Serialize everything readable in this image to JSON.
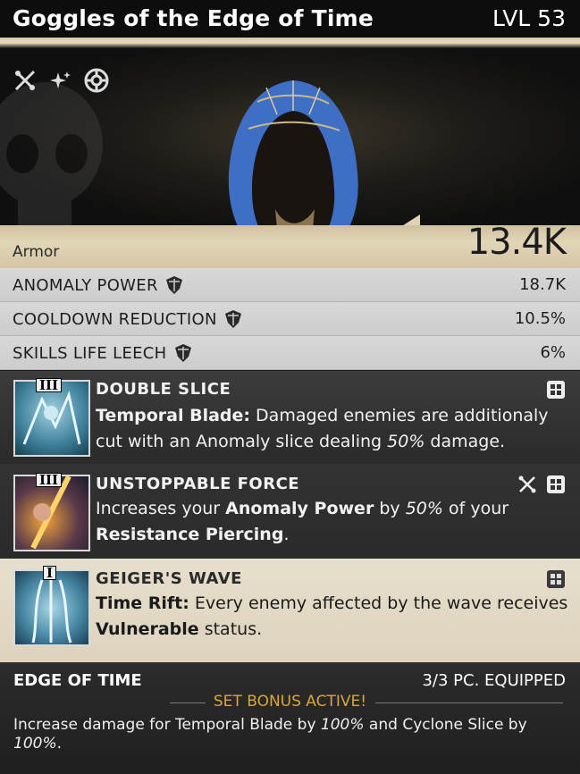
{
  "item": {
    "name": "Goggles of the Edge of Time",
    "level": "LVL 53",
    "hero_icons": [
      "crossed-tools-icon",
      "sparkle-icon",
      "crosshair-icon"
    ],
    "armor_label": "Armor",
    "armor_value": "13.4K"
  },
  "stats": [
    {
      "name": "ANOMALY POWER",
      "value": "18.7K",
      "icon": "gem-shield-icon"
    },
    {
      "name": "COOLDOWN REDUCTION",
      "value": "10.5%",
      "icon": "gem-shield-icon"
    },
    {
      "name": "SKILLS LIFE LEECH",
      "value": "6%",
      "icon": "gem-shield-icon"
    }
  ],
  "perks": [
    {
      "tier": "III",
      "name": "DOUBLE SLICE",
      "desc_lead": "Temporal Blade:",
      "desc_1": " Damaged enemies are additionaly cut with an Anomaly slice dealing ",
      "desc_em": "50%",
      "desc_2": " damage.",
      "icons": [
        "grid-icon"
      ]
    },
    {
      "tier": "III",
      "name": "UNSTOPPABLE FORCE",
      "desc_1": "Increases your ",
      "desc_b1": "Anomaly Power",
      "desc_2": " by ",
      "desc_em": "50%",
      "desc_3": " of your ",
      "desc_b2": "Resistance Piercing",
      "desc_4": ".",
      "icons": [
        "crossed-tools-icon",
        "grid-icon"
      ]
    },
    {
      "tier": "I",
      "name": "GEIGER'S WAVE",
      "desc_lead": "Time Rift:",
      "desc_1": " Every enemy affected by the wave receives ",
      "desc_b1": "Vulnerable",
      "desc_2": " status.",
      "icons": [
        "grid-icon"
      ]
    }
  ],
  "set": {
    "name": "EDGE OF TIME",
    "equipped": "3/3 PC. EQUIPPED",
    "active": "SET BONUS ACTIVE!",
    "desc_1": "Increase damage for Temporal Blade by ",
    "desc_em1": "100%",
    "desc_2": " and Cyclone Slice by ",
    "desc_em2": "100%",
    "desc_3": "."
  },
  "colors": {
    "set_active": "#d9a63a",
    "hood_blue": "#3f6fc4",
    "parchment": "#e2d6b8"
  }
}
